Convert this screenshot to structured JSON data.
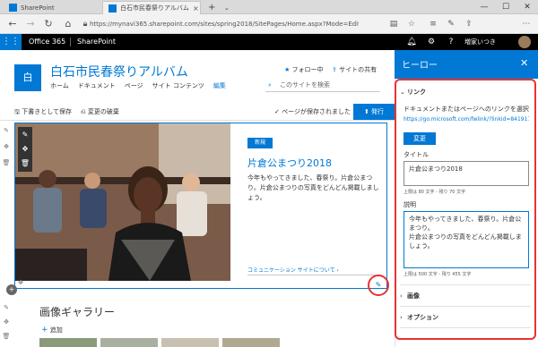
{
  "browser": {
    "tabs": [
      {
        "label": "SharePoint"
      },
      {
        "label": "白石市民春祭りアルバム"
      }
    ],
    "new_tab": "+",
    "tab_dropdown": "⌄",
    "url": "https://mynavi365.sharepoint.com/sites/spring2018/SitePages/Home.aspx?Mode=Edit",
    "window": {
      "minimize": "—",
      "maximize": "☐",
      "close": "✕"
    }
  },
  "suite": {
    "waffle": "⋮⋮",
    "product": "Office 365",
    "app": "SharePoint",
    "user": "増家いつき"
  },
  "site": {
    "logo": "白",
    "title": "白石市民春祭りアルバム",
    "nav": [
      "ホーム",
      "ドキュメント",
      "ページ",
      "サイト コンテンツ",
      "編集"
    ],
    "follow": "フォロー中",
    "share": "サイトの共有",
    "search_placeholder": "このサイトを検索"
  },
  "command_bar": {
    "save_draft": "下書きとして保存",
    "discard": "変更の破棄",
    "saved_status": "ページが保存されました",
    "publish": "発行"
  },
  "hero": {
    "badge": "新規",
    "title": "片倉公まつり2018",
    "description": "今年もやってきました、春祭り。片倉公まつり。片倉公まつりの写真をどんどん掲載しましょう。",
    "link": "コミュニケーション サイトについて ›"
  },
  "gallery": {
    "title": "画像ギャラリー",
    "add": "追加"
  },
  "panel": {
    "title": "ヒーロー",
    "close": "✕",
    "link_section": "リンク",
    "link_hint": "ドキュメントまたはページへのリンクを選択",
    "link_url": "https://go.microsoft.com/fwlink/?linkid=841917",
    "change_button": "変更",
    "title_label": "タイトル",
    "title_value": "片倉公まつり2018",
    "title_hint": "上限は 80 文字 - 残り 70 文字",
    "desc_label": "説明",
    "desc_value": "今年もやってきました、春祭り。片倉公まつり。\n片倉公まつりの写真をどんどん掲載しましょう。",
    "desc_hint": "上限は 500 文字 - 残り 455 文字",
    "image_section": "画像",
    "options_section": "オプション"
  },
  "colors": {
    "accent": "#0078d4",
    "suite_bar": "#000000",
    "highlight": "#e83232"
  }
}
